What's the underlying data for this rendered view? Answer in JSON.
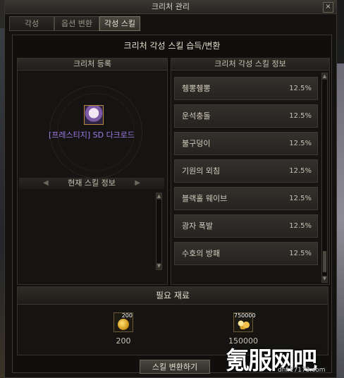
{
  "window": {
    "title": "크리처 관리",
    "close_glyph": "×"
  },
  "tabs": [
    {
      "label": "각성",
      "active": false
    },
    {
      "label": "옵션 변환",
      "active": false
    },
    {
      "label": "각성 스킬",
      "active": true
    }
  ],
  "section_title": "크리처 각성 스킬 습득/변환",
  "register_panel": {
    "title": "크리처 등록",
    "creature_name": "[프레스티지] SD 다크로드",
    "current_skill_title": "현재 스킬 정보"
  },
  "skill_panel": {
    "title": "크리처 각성 스킬 정보",
    "skills": [
      {
        "name": "췡뽕췡뽕",
        "rate": "12.5%"
      },
      {
        "name": "운석충돌",
        "rate": "12.5%"
      },
      {
        "name": "불구덩이",
        "rate": "12.5%"
      },
      {
        "name": "기원의 외침",
        "rate": "12.5%"
      },
      {
        "name": "블랙홀 웨이브",
        "rate": "12.5%"
      },
      {
        "name": "광자 폭발",
        "rate": "12.5%"
      },
      {
        "name": "수호의 방패",
        "rate": "12.5%"
      }
    ]
  },
  "materials": {
    "title": "필요 재료",
    "items": [
      {
        "icon": "coin-icon",
        "badge": "200",
        "count": "200"
      },
      {
        "icon": "gold-pile-icon",
        "badge": "750000",
        "count": "150000"
      }
    ]
  },
  "convert_button": "스킬 변환하기",
  "watermark": {
    "big": "氪服网吧",
    "small": "dnf.17173.com"
  },
  "colors": {
    "creature_name": "#9f7be8",
    "accent_border": "#6d6658"
  }
}
